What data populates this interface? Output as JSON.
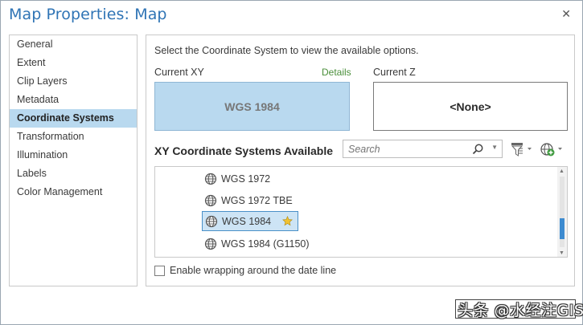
{
  "dialog": {
    "title": "Map Properties: Map",
    "close_glyph": "✕"
  },
  "sidebar": {
    "items": [
      {
        "label": "General",
        "active": false
      },
      {
        "label": "Extent",
        "active": false
      },
      {
        "label": "Clip Layers",
        "active": false
      },
      {
        "label": "Metadata",
        "active": false
      },
      {
        "label": "Coordinate Systems",
        "active": true
      },
      {
        "label": "Transformation",
        "active": false
      },
      {
        "label": "Illumination",
        "active": false
      },
      {
        "label": "Labels",
        "active": false
      },
      {
        "label": "Color Management",
        "active": false
      }
    ]
  },
  "main": {
    "instruction": "Select the Coordinate System to view the available options.",
    "current_xy_label": "Current XY",
    "details_link": "Details",
    "current_z_label": "Current Z",
    "current_xy_value": "WGS 1984",
    "current_z_value": "<None>",
    "available_label": "XY Coordinate Systems Available",
    "search": {
      "placeholder": "Search",
      "value": ""
    },
    "list_items": [
      {
        "label": "WGS 1972",
        "selected": false,
        "favorite": false
      },
      {
        "label": "WGS 1972 TBE",
        "selected": false,
        "favorite": false
      },
      {
        "label": "WGS 1984",
        "selected": true,
        "favorite": true
      },
      {
        "label": "WGS 1984 (G1150)",
        "selected": false,
        "favorite": false
      }
    ],
    "scroll_position": 0.75,
    "wrap_checkbox": {
      "label": "Enable wrapping around the date line",
      "checked": false
    }
  },
  "watermark": {
    "text": "头条 @水经注GIS"
  },
  "colors": {
    "title": "#2f74b5",
    "selection": "#b9d9ef",
    "details_link": "#4a8f3a",
    "scroll_thumb": "#3d8bd0"
  },
  "icons": {
    "close": "close-icon",
    "search": "search-icon",
    "filter": "filter-icon",
    "add_coordinate_system": "globe-add-icon",
    "list_item": "globe-icon",
    "favorite": "star-icon"
  }
}
